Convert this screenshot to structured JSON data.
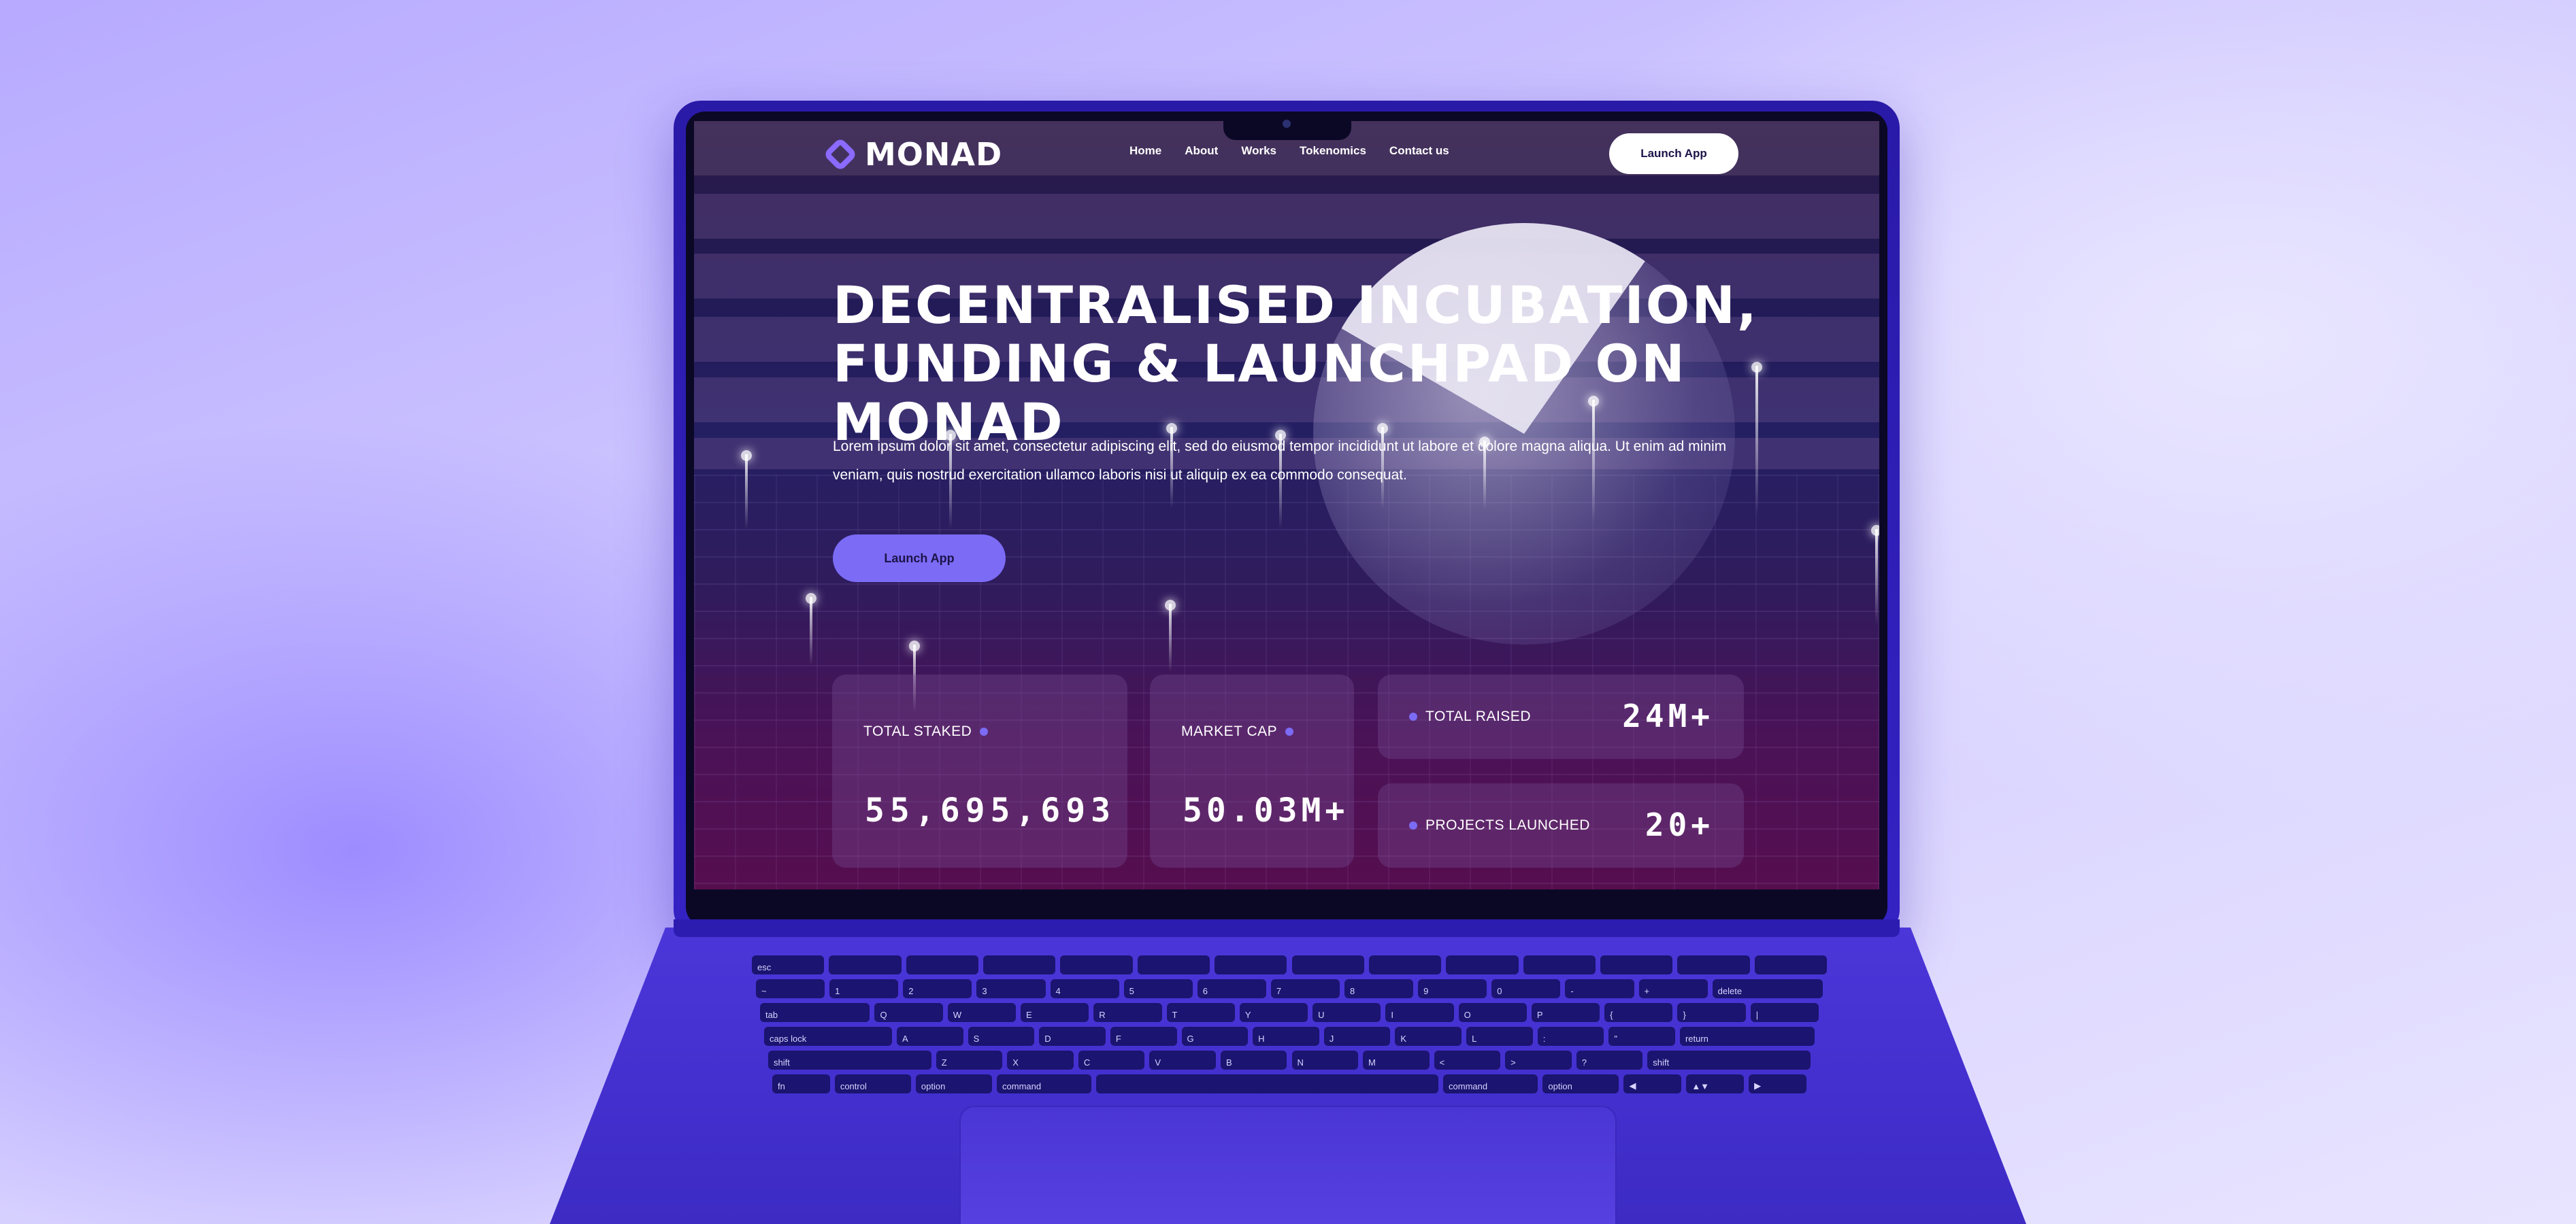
{
  "nav": {
    "logo_text": "MONAD",
    "links": [
      "Home",
      "About",
      "Works",
      "Tokenomics",
      "Contact us"
    ],
    "cta_label": "Launch App"
  },
  "hero": {
    "headline_line1": "DECENTRALISED INCUBATION,",
    "headline_line2": "FUNDING & LAUNCHPAD ON MONAD",
    "paragraph": "Lorem ipsum dolor sit amet, consectetur adipiscing elit, sed do eiusmod tempor incididunt ut labore et dolore magna aliqua. Ut enim ad minim veniam, quis nostrud exercitation ullamco laboris nisi ut aliquip ex ea commodo consequat.",
    "cta_label": "Launch App"
  },
  "stats": {
    "total_staked": {
      "label": "TOTAL STAKED",
      "value": "55,695,693"
    },
    "market_cap": {
      "label": "MARKET CAP",
      "value": "50.03M+"
    },
    "total_raised": {
      "label": "TOTAL RAISED",
      "value": "24M+"
    },
    "projects_launched": {
      "label": "PROJECTS LAUNCHED",
      "value": "20+"
    }
  },
  "keyboard": {
    "rows": [
      [
        "esc",
        "",
        "",
        "",
        "",
        "",
        "",
        "",
        "",
        "",
        "",
        "",
        "",
        ""
      ],
      [
        "~",
        "1",
        "2",
        "3",
        "4",
        "5",
        "6",
        "7",
        "8",
        "9",
        "0",
        "-",
        "+",
        "delete"
      ],
      [
        "tab",
        "Q",
        "W",
        "E",
        "R",
        "T",
        "Y",
        "U",
        "I",
        "O",
        "P",
        "{",
        "}",
        "|"
      ],
      [
        "caps lock",
        "A",
        "S",
        "D",
        "F",
        "G",
        "H",
        "J",
        "K",
        "L",
        ":",
        "\"",
        "return"
      ],
      [
        "shift",
        "Z",
        "X",
        "C",
        "V",
        "B",
        "N",
        "M",
        "<",
        ">",
        "?",
        "shift"
      ],
      [
        "fn",
        "control",
        "option",
        "command",
        "",
        "command",
        "option",
        "◀",
        "▲▼",
        "▶"
      ]
    ]
  },
  "colors": {
    "accent": "#7b6bf5",
    "background": "#c9c0ff",
    "laptop": "#3422c4"
  }
}
